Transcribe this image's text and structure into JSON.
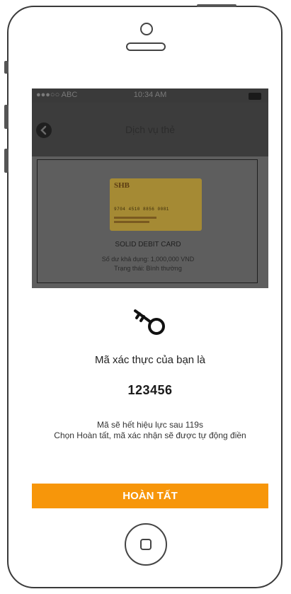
{
  "status_bar": {
    "carrier": "●●●○○ ABC",
    "time": "10:34 AM"
  },
  "nav": {
    "title": "Dịch vụ thẻ"
  },
  "card": {
    "bank": "SHB",
    "number": "9704 4510 8856 0081",
    "name": "SOLID DEBIT CARD",
    "balance": "Số dư khả dụng: 1,000,000 VND",
    "status": "Trạng thái: Bình thường"
  },
  "modal": {
    "title": "Mã xác thực của bạn là",
    "code": "123456",
    "note_line1": "Mã sẽ hết hiệu lực sau 119s",
    "note_line2": "Chọn Hoàn tất, mã xác nhận sẽ được tự động điền"
  },
  "actions": {
    "done_label": "HOÀN TẤT"
  },
  "colors": {
    "accent": "#f7960a",
    "overlay": "#5d5d5d"
  }
}
